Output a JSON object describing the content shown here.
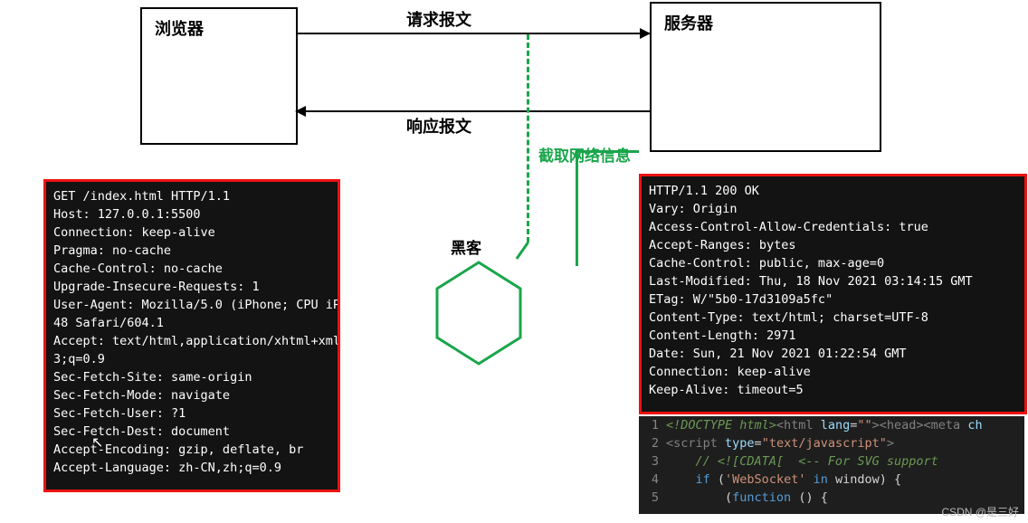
{
  "boxes": {
    "browser": "浏览器",
    "server": "服务器"
  },
  "labels": {
    "request": "请求报文",
    "response": "响应报文",
    "intercept": "截取网络信息",
    "hacker": "黑客"
  },
  "request_raw": "GET /index.html HTTP/1.1\nHost: 127.0.0.1:5500\nConnection: keep-alive\nPragma: no-cache\nCache-Control: no-cache\nUpgrade-Insecure-Requests: 1\nUser-Agent: Mozilla/5.0 (iPhone; CPU iP\n48 Safari/604.1\nAccept: text/html,application/xhtml+xml\n3;q=0.9\nSec-Fetch-Site: same-origin\nSec-Fetch-Mode: navigate\nSec-Fetch-User: ?1\nSec-Fetch-Dest: document\nAccept-Encoding: gzip, deflate, br\nAccept-Language: zh-CN,zh;q=0.9",
  "response_raw": "HTTP/1.1 200 OK\nVary: Origin\nAccess-Control-Allow-Credentials: true\nAccept-Ranges: bytes\nCache-Control: public, max-age=0\nLast-Modified: Thu, 18 Nov 2021 03:14:15 GMT\nETag: W/\"5b0-17d3109a5fc\"\nContent-Type: text/html; charset=UTF-8\nContent-Length: 2971\nDate: Sun, 21 Nov 2021 01:22:54 GMT\nConnection: keep-alive\nKeep-Alive: timeout=5",
  "code": {
    "l1": {
      "pre": "<!DOCTYPE html>",
      "tag1": "<html ",
      "attr1": "lang",
      "eq": "=",
      "val1": "\"\"",
      "tag1b": ">",
      "tag2": "<head>",
      "tag3": "<meta ",
      "attr2": "ch"
    },
    "l2": {
      "tag": "<script ",
      "attr": "type",
      "eq": "=",
      "val": "\"text/javascript\"",
      "close": ">"
    },
    "l3": "    // <![CDATA[  <-- For SVG support",
    "l4": {
      "pre": "    ",
      "kw": "if",
      "open": " (",
      "str": "'WebSocket'",
      "mid": " ",
      "kw2": "in",
      "post": " window) {"
    },
    "l5": {
      "pre": "        (",
      "fn": "function",
      "post": " () {"
    }
  },
  "watermark": "CSDN @是三好"
}
